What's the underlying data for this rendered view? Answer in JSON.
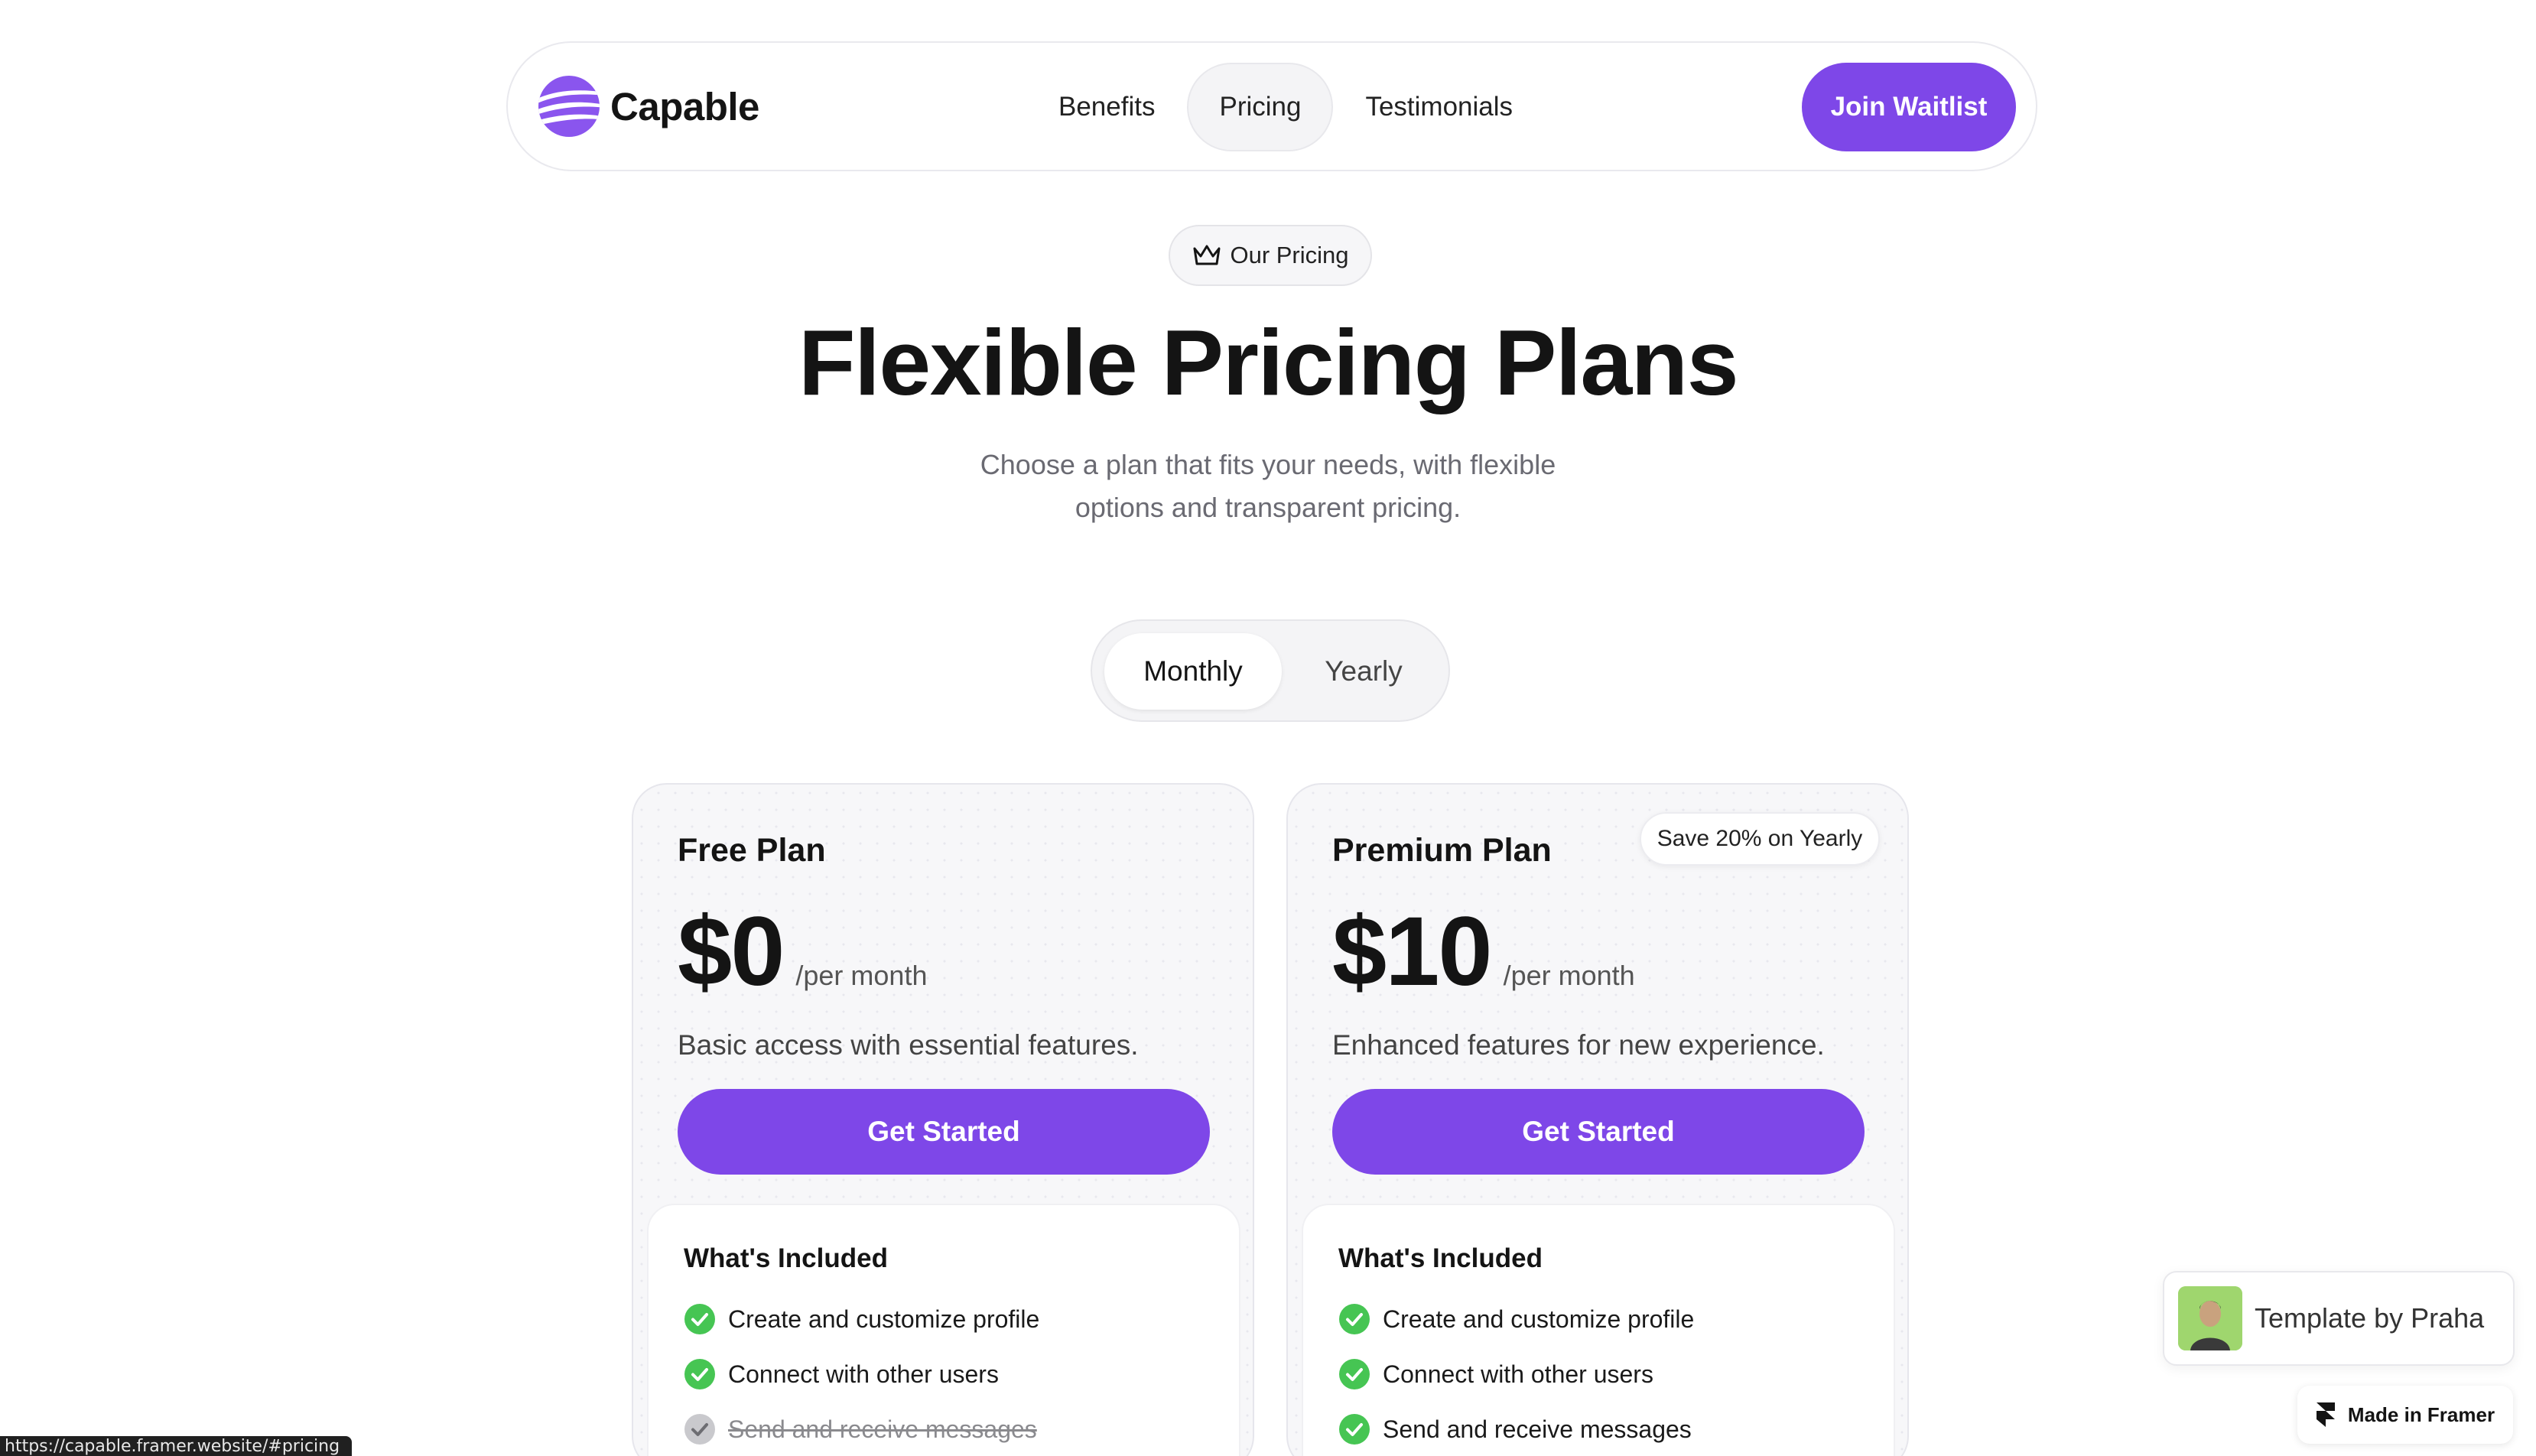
{
  "nav": {
    "brand": "Capable",
    "links": [
      "Benefits",
      "Pricing",
      "Testimonials"
    ],
    "active_link": "Pricing",
    "cta": "Join Waitlist"
  },
  "hero": {
    "tag": "Our Pricing",
    "title": "Flexible Pricing Plans",
    "subtitle_line1": "Choose a plan that fits your needs, with flexible",
    "subtitle_line2": "options and transparent pricing."
  },
  "billing_toggle": {
    "options": [
      "Monthly",
      "Yearly"
    ],
    "selected": "Monthly"
  },
  "plans": [
    {
      "name": "Free Plan",
      "price": "$0",
      "period": "/per month",
      "description": "Basic access with essential features.",
      "cta": "Get Started",
      "included_title": "What's Included",
      "features": [
        {
          "text": "Create and customize profile",
          "included": true
        },
        {
          "text": "Connect with other users",
          "included": true
        },
        {
          "text": "Send and receive messages",
          "included": false
        }
      ]
    },
    {
      "name": "Premium Plan",
      "badge": "Save 20% on Yearly",
      "price": "$10",
      "period": "/per month",
      "description": "Enhanced features for new experience.",
      "cta": "Get Started",
      "included_title": "What's Included",
      "features": [
        {
          "text": "Create and customize profile",
          "included": true
        },
        {
          "text": "Connect with other users",
          "included": true
        },
        {
          "text": "Send and receive messages",
          "included": true
        }
      ]
    }
  ],
  "status_url": "https://capable.framer.website/#pricing",
  "template_badge": "Template by Praha",
  "framer_badge": "Made in Framer",
  "colors": {
    "accent": "#7e47e8",
    "check_on": "#46c553",
    "check_off": "#c9c9cd"
  },
  "icons": [
    "brand-logo-icon",
    "crown-icon",
    "check-circle-icon",
    "framer-icon"
  ]
}
